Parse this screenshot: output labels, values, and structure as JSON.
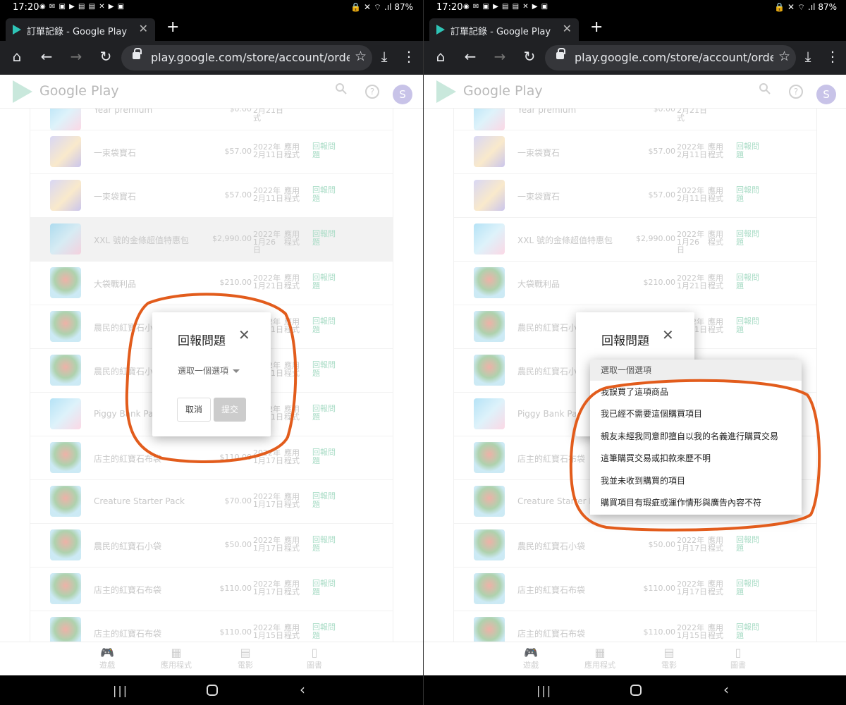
{
  "status": {
    "time": "17:20",
    "left_icons": "◉ ✉ ▣ ▶ ▤ ▤ ✕ ▶ ▣",
    "right": "🔒 ✕ ⌔ .ıl 87%"
  },
  "browser": {
    "tab_title": "訂單記錄 - Google Play",
    "tab_close": "✕",
    "new_tab": "+",
    "url": "play.google.com/store/account/orderhis",
    "home_icon": "⌂",
    "back_icon": "←",
    "forward_icon": "→",
    "reload_icon": "↻",
    "star_icon": "☆",
    "download_icon": "⤓",
    "menu_icon": "⋮"
  },
  "gplay": {
    "logo_text": "Google Play",
    "avatar_letter": "S",
    "help": "?"
  },
  "orders": [
    {
      "name": "Year premium",
      "price": "$0.00",
      "date": "2月21日式",
      "type": "",
      "report": "",
      "thumb": "gift"
    },
    {
      "name": "一束袋寶石",
      "price": "$57.00",
      "date": "2022年 2月11日",
      "type": "應用程式",
      "report": "回報問題",
      "thumb": "fairy"
    },
    {
      "name": "一束袋寶石",
      "price": "$57.00",
      "date": "2022年 2月11日",
      "type": "應用程式",
      "report": "回報問題",
      "thumb": "fairy"
    },
    {
      "name": "XXL 號的金條超值特惠包",
      "price": "$2,990.00",
      "date": "2022年 1月26 日",
      "type": "應用程式",
      "report": "回報問題",
      "thumb": "gift"
    },
    {
      "name": "大袋戰利品",
      "price": "$210.00",
      "date": "2022年 1月21日",
      "type": "應用程式",
      "report": "回報問題",
      "thumb": "tree"
    },
    {
      "name": "農民的紅寶石小袋",
      "price": "$50.00",
      "date": "2022年 1月21日",
      "type": "應用程式",
      "report": "回報問題",
      "thumb": "tree"
    },
    {
      "name": "農民的紅寶石小袋",
      "price": "$50.00",
      "date": "2022年 1月21日",
      "type": "應用程式",
      "report": "回報問題",
      "thumb": "tree"
    },
    {
      "name": "Piggy Bank Pack",
      "price": "$50.00",
      "date": "2022年 1月21日",
      "type": "應用程式",
      "report": "回報問題",
      "thumb": "gift"
    },
    {
      "name": "店主的紅寶石布袋",
      "price": "$110.00",
      "date": "2022年 1月17日",
      "type": "應用程式",
      "report": "回報問題",
      "thumb": "tree"
    },
    {
      "name": "Creature Starter Pack",
      "price": "$70.00",
      "date": "2022年 1月17日",
      "type": "應用程式",
      "report": "回報問題",
      "thumb": "tree"
    },
    {
      "name": "農民的紅寶石小袋",
      "price": "$50.00",
      "date": "2022年 1月17日",
      "type": "應用程式",
      "report": "回報問題",
      "thumb": "tree"
    },
    {
      "name": "店主的紅寶石布袋",
      "price": "$110.00",
      "date": "2022年 1月17日",
      "type": "應用程式",
      "report": "回報問題",
      "thumb": "tree"
    },
    {
      "name": "店主的紅寶石布袋",
      "price": "$110.00",
      "date": "2022年 1月15日",
      "type": "應用程式",
      "report": "回報問題",
      "thumb": "tree"
    }
  ],
  "bottom_nav": [
    {
      "icon": "🎮",
      "label": "遊戲"
    },
    {
      "icon": "▦",
      "label": "應用程式"
    },
    {
      "icon": "▤",
      "label": "電影"
    },
    {
      "icon": "▯",
      "label": "圖書"
    }
  ],
  "system_nav": {
    "recent": "|||",
    "back": "‹"
  },
  "dialog": {
    "title": "回報問題",
    "close": "✕",
    "select_placeholder": "選取一個選項",
    "cancel": "取消",
    "submit": "提交"
  },
  "dropdown": {
    "options": [
      "選取一個選項",
      "我誤買了這項商品",
      "我已經不需要這個購買項目",
      "親友未經我同意即擅自以我的名義進行購買交易",
      "這筆購買交易或扣款來歷不明",
      "我並未收到購買的項目",
      "購買項目有瑕疵或運作情形與廣告內容不符"
    ]
  },
  "colors": {
    "annotation": "#e25c1c",
    "report_link": "#a9dcc6"
  }
}
